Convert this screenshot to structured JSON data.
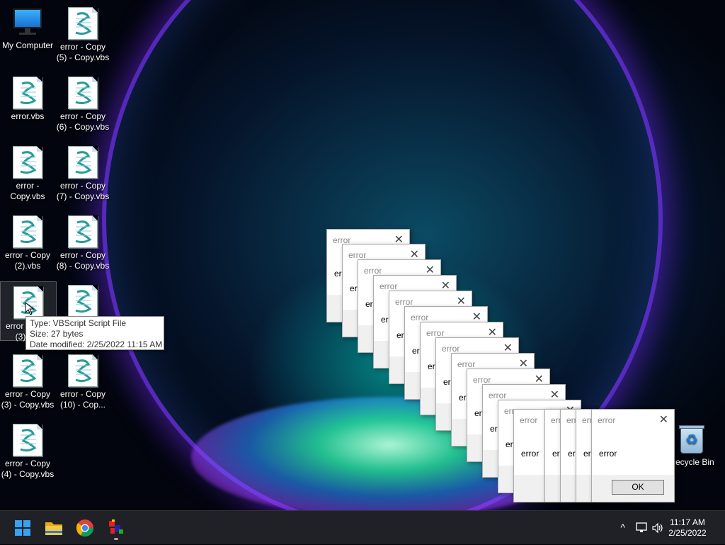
{
  "desktop_icons": [
    {
      "label": "My Computer",
      "type": "computer"
    },
    {
      "label": "error.vbs",
      "type": "vbs"
    },
    {
      "label": "error - Copy.vbs",
      "type": "vbs"
    },
    {
      "label": "error - Copy (2).vbs",
      "type": "vbs"
    },
    {
      "label": "error - Copy (3).vbs",
      "type": "vbs"
    },
    {
      "label": "error - Copy (3) - Copy.vbs",
      "type": "vbs"
    },
    {
      "label": "error - Copy (4) - Copy.vbs",
      "type": "vbs"
    },
    {
      "label": "error - Copy (5) - Copy.vbs",
      "type": "vbs"
    },
    {
      "label": "error - Copy (6) - Copy.vbs",
      "type": "vbs"
    },
    {
      "label": "error - Copy (7) - Copy.vbs",
      "type": "vbs"
    },
    {
      "label": "error - Copy (8) - Copy.vbs",
      "type": "vbs"
    },
    {
      "label": "",
      "type": "vbs"
    },
    {
      "label": "error - Copy (10) - Cop...",
      "type": "vbs"
    },
    {
      "label": "Recycle Bin",
      "type": "recycle-bin"
    }
  ],
  "tooltip": {
    "type_line": "Type: VBScript Script File",
    "size_line": "Size: 27 bytes",
    "date_line": "Date modified: 2/25/2022 11:15 AM"
  },
  "dialog": {
    "title": "error",
    "message": "error",
    "ok_label": "OK",
    "close_glyph": "✕",
    "count": 17
  },
  "taskbar": {
    "apps": [
      "start-icon",
      "file-explorer-icon",
      "chrome-icon",
      "app-icon"
    ],
    "tray": {
      "chevron": "^",
      "time": "11:17 AM",
      "date": "2/25/2022"
    }
  }
}
